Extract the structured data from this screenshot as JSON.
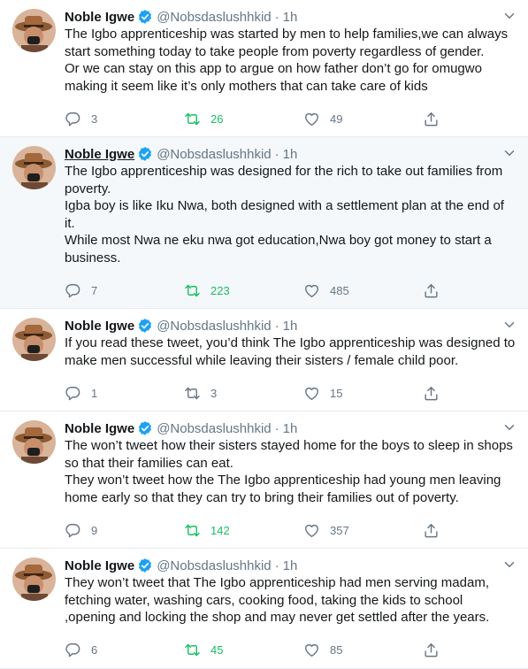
{
  "author": {
    "name": "Noble Igwe",
    "handle": "@Nobsdaslushhkid",
    "separator": "·",
    "time": "1h"
  },
  "tweets": [
    {
      "lines": [
        "The Igbo apprenticeship was started by men to help families,we can always start something today to take people from poverty regardless of gender.",
        "Or we can stay on this app to argue on how father don’t go for omugwo making it seem like it’s only mothers that can take care of kids"
      ],
      "replies": "3",
      "retweets": "26",
      "likes": "49"
    },
    {
      "lines": [
        "The Igbo apprenticeship was designed for the rich to take out families from poverty.",
        "Igba boy is like Iku Nwa, both designed with a settlement plan at the end of it.",
        "While most Nwa ne eku nwa got education,Nwa boy got money to start a business."
      ],
      "replies": "7",
      "retweets": "223",
      "likes": "485"
    },
    {
      "lines": [
        "If you read these tweet, you’d think The Igbo apprenticeship was designed to make men successful while leaving their sisters / female child poor."
      ],
      "replies": "1",
      "retweets": "3",
      "likes": "15"
    },
    {
      "lines": [
        "The won’t tweet how their sisters stayed home for the boys to sleep in shops so that their families can eat.",
        "They won’t tweet how the The Igbo apprenticeship had young men leaving home early so that they can try to bring  their families out of poverty."
      ],
      "replies": "9",
      "retweets": "142",
      "likes": "357"
    },
    {
      "lines": [
        "They won’t tweet that The Igbo apprenticeship had men serving madam, fetching water, washing cars, cooking food, taking the kids to school ,opening and locking the shop and may never get settled after the years."
      ],
      "replies": "6",
      "retweets": "45",
      "likes": "85"
    }
  ],
  "colors": {
    "text": "#14171a",
    "muted": "#657786",
    "verified": "#1da1f2",
    "retweet_active": "#17bf63",
    "hover_bg": "#f5f8fa",
    "divider": "#e6ecf0"
  },
  "icons": {
    "reply": "speech-bubble-icon",
    "retweet": "retweet-arrows-icon",
    "like": "heart-outline-icon",
    "share": "share-arrow-icon",
    "verified": "verified-badge-icon",
    "menu": "chevron-down-icon"
  }
}
